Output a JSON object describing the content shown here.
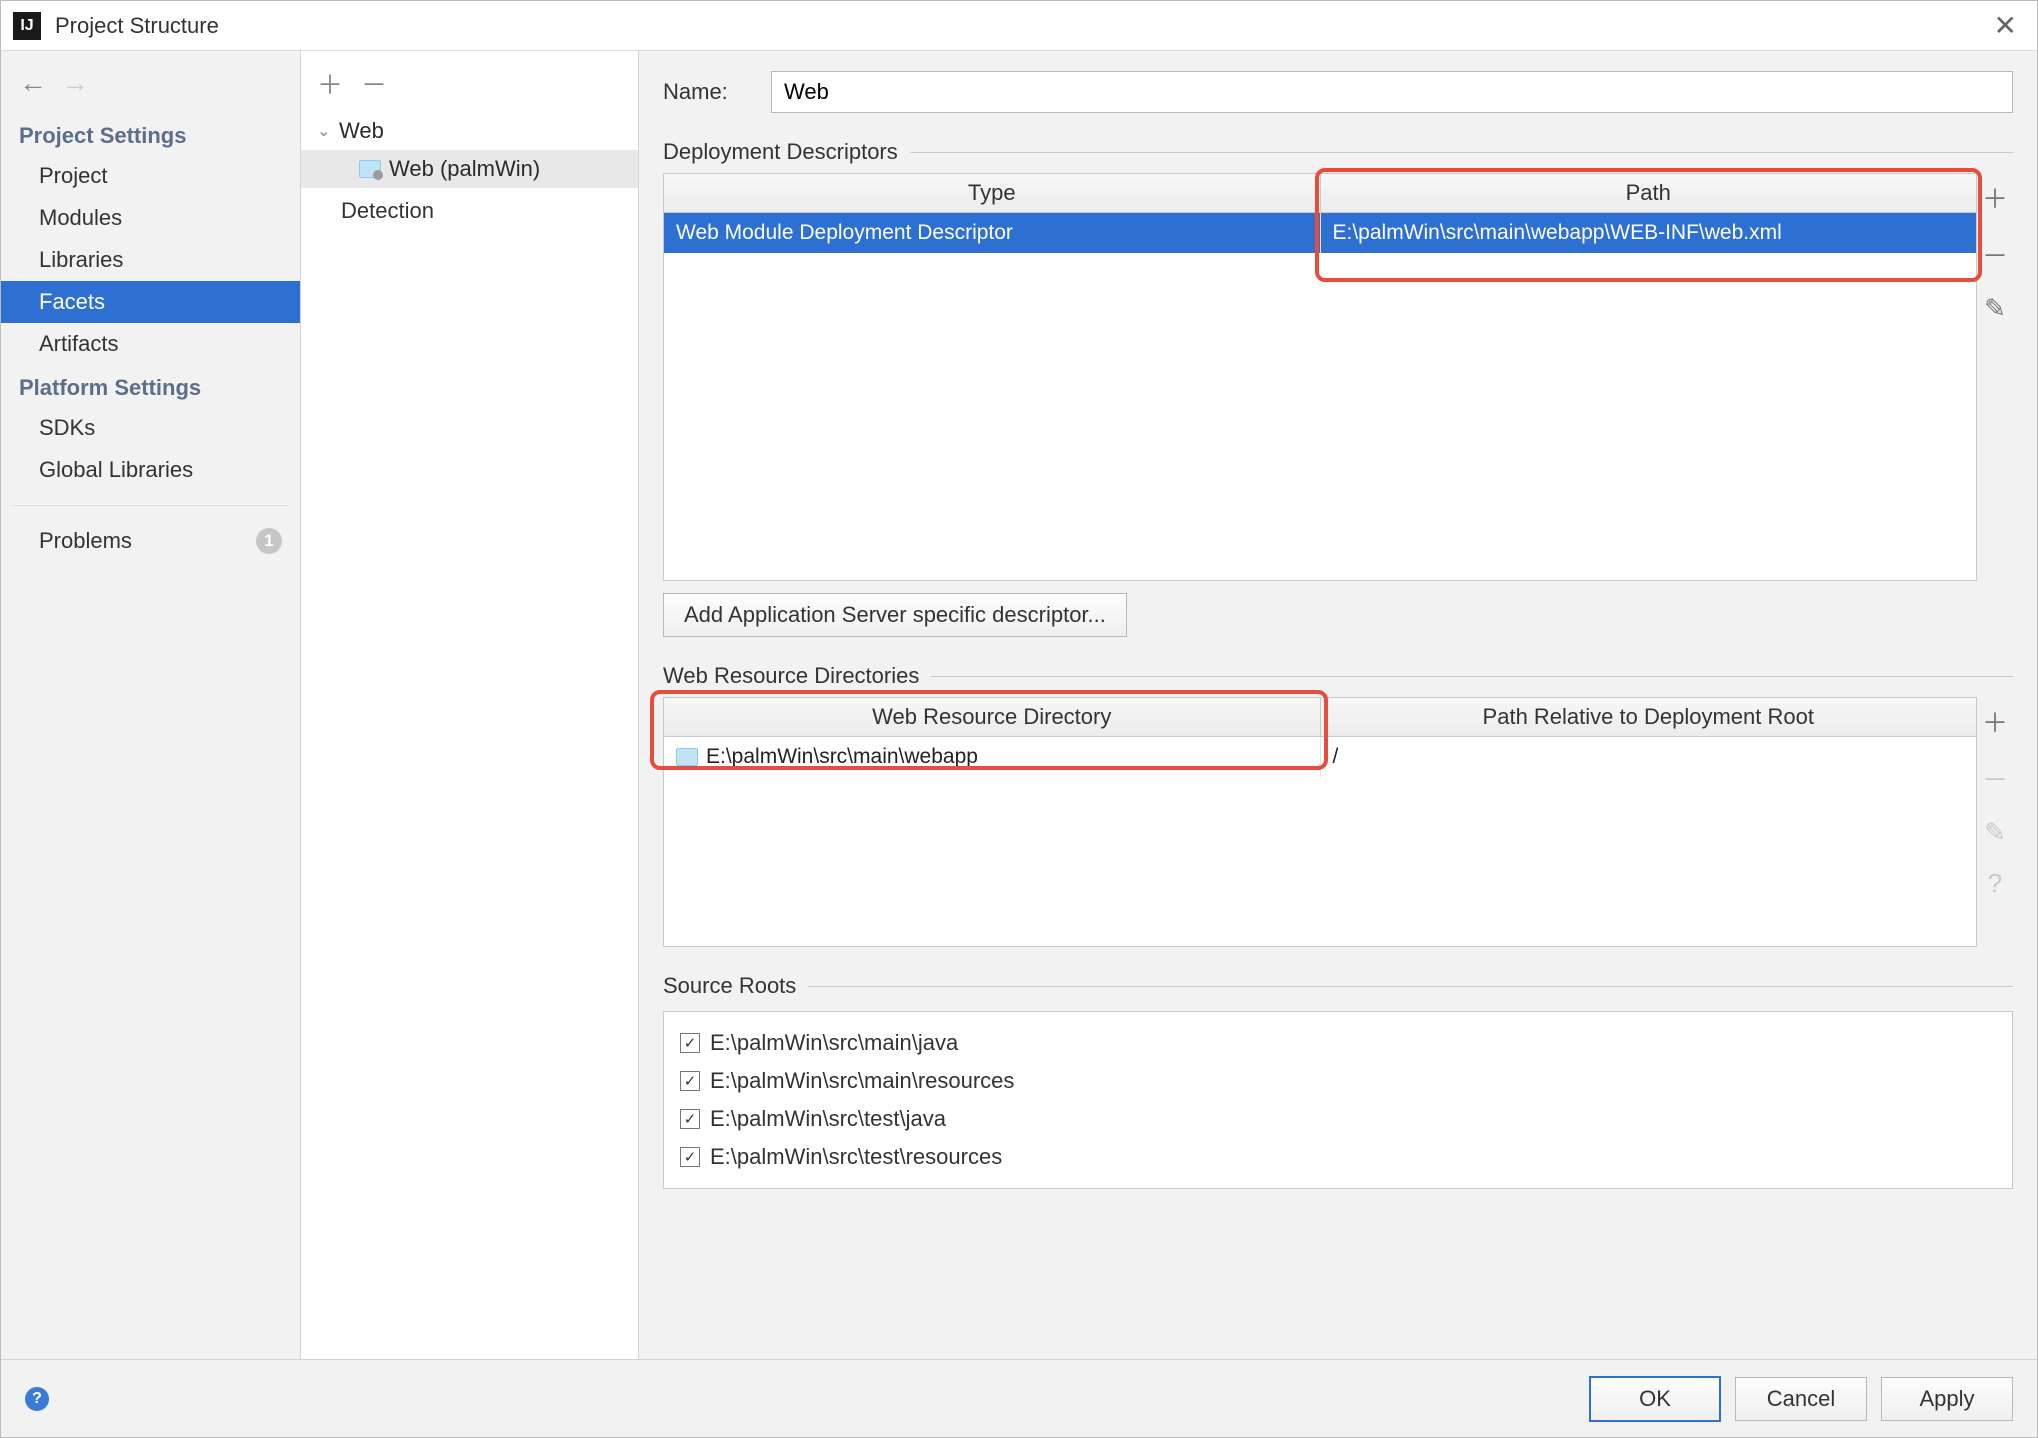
{
  "window": {
    "title": "Project Structure"
  },
  "sidebar": {
    "sections": {
      "project_settings_heading": "Project Settings",
      "platform_settings_heading": "Platform Settings"
    },
    "items": {
      "project": "Project",
      "modules": "Modules",
      "libraries": "Libraries",
      "facets": "Facets",
      "artifacts": "Artifacts",
      "sdks": "SDKs",
      "global_libraries": "Global Libraries",
      "problems": "Problems"
    },
    "problems_count": "1"
  },
  "tree": {
    "web_node": "Web",
    "web_palmwin": "Web (palmWin)",
    "detection": "Detection"
  },
  "form": {
    "name_label": "Name:",
    "name_value": "Web",
    "deployment_descriptors_label": "Deployment Descriptors",
    "dd_columns": {
      "type": "Type",
      "path": "Path"
    },
    "dd_rows": [
      {
        "type": "Web Module Deployment Descriptor",
        "path": "E:\\palmWin\\src\\main\\webapp\\WEB-INF\\web.xml"
      }
    ],
    "add_descriptor_btn": "Add Application Server specific descriptor...",
    "web_res_dirs_label": "Web Resource Directories",
    "wr_columns": {
      "dir": "Web Resource Directory",
      "rel": "Path Relative to Deployment Root"
    },
    "wr_rows": [
      {
        "dir": "E:\\palmWin\\src\\main\\webapp",
        "rel": "/"
      }
    ],
    "source_roots_label": "Source Roots",
    "source_roots": [
      "E:\\palmWin\\src\\main\\java",
      "E:\\palmWin\\src\\main\\resources",
      "E:\\palmWin\\src\\test\\java",
      "E:\\palmWin\\src\\test\\resources"
    ]
  },
  "footer": {
    "ok": "OK",
    "cancel": "Cancel",
    "apply": "Apply"
  }
}
